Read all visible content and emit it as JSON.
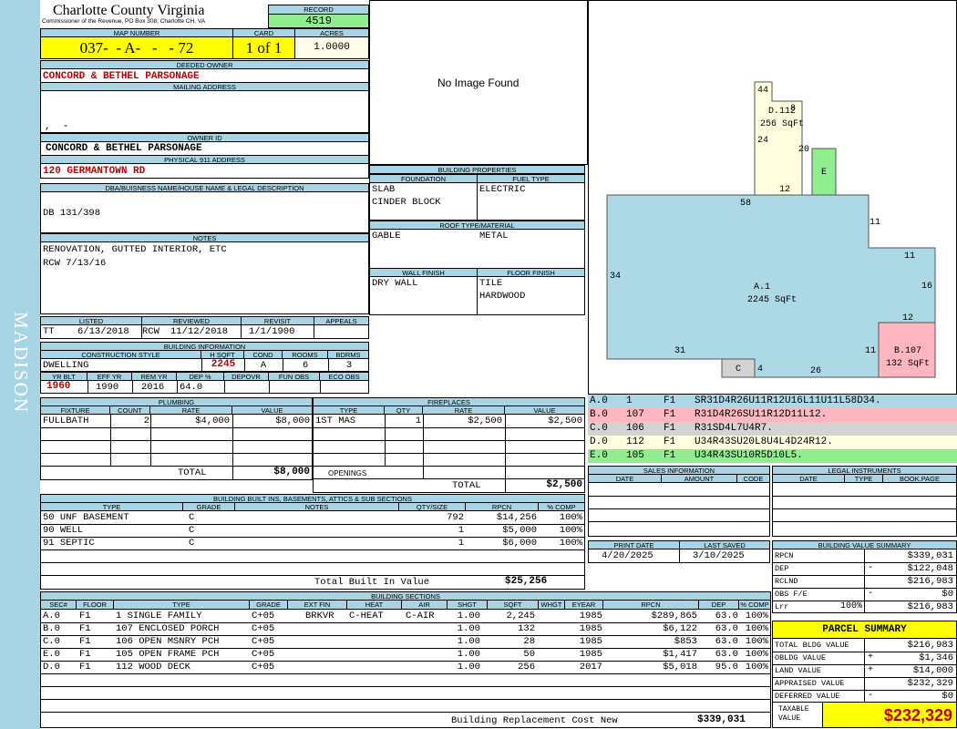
{
  "side_label": "MADISON",
  "header": {
    "county": "Charlotte County Virginia",
    "commissioner": "Commissioner of the Revenue, PO Box 308, Charlotte CH, VA",
    "record_label": "RECORD",
    "record": "4519",
    "map_label": "MAP NUMBER",
    "map": "037-  - A-   -   - 72",
    "card_label": "CARD",
    "card": "1 of 1",
    "acres_label": "ACRES",
    "acres": "1.0000"
  },
  "owner": {
    "deeded_label": "DEEDED OWNER",
    "deeded": "CONCORD & BETHEL PARSONAGE",
    "mailing_label": "MAILING ADDRESS",
    "mailing": ",  -",
    "owner_id_label": "OWNER ID",
    "owner_id": "CONCORD & BETHEL PARSONAGE",
    "physical_label": "PHYSICAL 911 ADDRESS",
    "physical": "120 GERMANTOWN RD",
    "dba_label": "DBA/BUISNESS NAME/HOUSE NAME & LEGAL DESCRIPTION",
    "dba": "DB 131/398",
    "notes_label": "NOTES",
    "notes": [
      "RENOVATION, GUTTED INTERIOR, ETC",
      "RCW 7/13/16"
    ]
  },
  "image_text": "No Image Found",
  "building_props": {
    "title": "BUILDING PROPERTIES",
    "foundation_label": "FOUNDATION",
    "fuel_label": "FUEL TYPE",
    "foundation": [
      "SLAB",
      "CINDER BLOCK"
    ],
    "fuel": "ELECTRIC",
    "roof_label": "ROOF TYPE/MATERIAL",
    "roof_type": "GABLE",
    "roof_mat": "METAL",
    "wall_label": "WALL FINISH",
    "floor_label": "FLOOR FINISH",
    "wall": "DRY WALL",
    "floor": [
      "TILE",
      "HARDWOOD"
    ]
  },
  "dates": {
    "listed_label": "LISTED",
    "reviewed_label": "REVIEWED",
    "revisit_label": "REVISIT",
    "appeals_label": "APPEALS",
    "listed_by": "TT",
    "listed": "6/13/2018",
    "reviewed_by": "RCW",
    "reviewed": "11/12/2018",
    "revisit": "1/1/1900",
    "appeals": ""
  },
  "bldg_info": {
    "title": "BUILDING INFORMATION",
    "style_label": "CONSTRUCTION STYLE",
    "hsqft_label": "H SQFT",
    "cond_label": "COND",
    "rooms_label": "ROOMS",
    "bdrms_label": "BDRMS",
    "style": "DWELLING",
    "hsqft": "2245",
    "cond": "A",
    "rooms": "6",
    "bdrms": "3",
    "yrblt_label": "YR BLT",
    "effyr_label": "EFF YR",
    "remyr_label": "REM YR",
    "dep_label": "DEP %",
    "depovr_label": "DEPOVR",
    "funobs_label": "FUN OBS",
    "ecoobs_label": "ECO OBS",
    "yrblt": "1960",
    "effyr": "1990",
    "remyr": "2016",
    "dep": "64.0"
  },
  "plumbing": {
    "title": "PLUMBING",
    "cols": [
      "FIXTURE",
      "COUNT",
      "RATE",
      "VALUE"
    ],
    "rows": [
      {
        "fixture": "FULLBATH",
        "count": "2",
        "rate": "$4,000",
        "value": "$8,000"
      }
    ],
    "total_label": "TOTAL",
    "total": "$8,000"
  },
  "fireplaces": {
    "title": "FIREPLACES",
    "cols": [
      "TYPE",
      "QTY",
      "RATE",
      "VALUE"
    ],
    "rows": [
      {
        "type": "1ST MAS",
        "qty": "1",
        "rate": "$2,500",
        "value": "$2,500"
      }
    ],
    "openings_label": "OPENINGS",
    "total_label": "TOTAL",
    "total": "$2,500"
  },
  "builtins": {
    "title": "BUILDING BUILT INS, BASEMENTS, ATTICS & SUB SECTIONS",
    "cols": [
      "TYPE",
      "GRADE",
      "NOTES",
      "QTY/SIZE",
      "RPCN",
      "% COMP"
    ],
    "rows": [
      {
        "type": "50 UNF BASEMENT",
        "grade": "C",
        "qty": "792",
        "rpcn": "$14,256",
        "comp": "100%"
      },
      {
        "type": "90 WELL",
        "grade": "C",
        "qty": "1",
        "rpcn": "$5,000",
        "comp": "100%"
      },
      {
        "type": "91 SEPTIC",
        "grade": "C",
        "qty": "1",
        "rpcn": "$6,000",
        "comp": "100%"
      }
    ],
    "total_label": "Total Built In Value",
    "total": "$25,256"
  },
  "sections": {
    "title": "BUILDING SECTIONS",
    "cols": [
      "SEC#",
      "FLOOR",
      "TYPE",
      "GRADE",
      "EXT FIN",
      "HEAT",
      "AIR",
      "SHGT",
      "SQFT",
      "WHGT",
      "EYEAR",
      "RPCN",
      "DEP",
      "% COMP"
    ],
    "rows": [
      {
        "sec": "A.0",
        "floor": "F1",
        "type": "1 SINGLE FAMILY",
        "grade": "C+05",
        "ext": "BRKVR",
        "heat": "C-HEAT",
        "air": "C-AIR",
        "shgt": "1.00",
        "sqft": "2,245",
        "eyear": "1985",
        "rpcn": "$289,865",
        "dep": "63.0",
        "comp": "100%"
      },
      {
        "sec": "B.0",
        "floor": "F1",
        "type": "107 ENCLOSED PORCH",
        "grade": "C+05",
        "ext": "",
        "heat": "",
        "air": "",
        "shgt": "1.00",
        "sqft": "132",
        "eyear": "1985",
        "rpcn": "$6,122",
        "dep": "63.0",
        "comp": "100%"
      },
      {
        "sec": "C.0",
        "floor": "F1",
        "type": "106 OPEN MSNRY PCH",
        "grade": "C+05",
        "ext": "",
        "heat": "",
        "air": "",
        "shgt": "1.00",
        "sqft": "28",
        "eyear": "1985",
        "rpcn": "$853",
        "dep": "63.0",
        "comp": "100%"
      },
      {
        "sec": "E.0",
        "floor": "F1",
        "type": "105 OPEN FRAME PCH",
        "grade": "C+05",
        "ext": "",
        "heat": "",
        "air": "",
        "shgt": "1.00",
        "sqft": "50",
        "eyear": "1985",
        "rpcn": "$1,417",
        "dep": "63.0",
        "comp": "100%"
      },
      {
        "sec": "D.0",
        "floor": "F1",
        "type": "112 WOOD DECK",
        "grade": "C+05",
        "ext": "",
        "heat": "",
        "air": "",
        "shgt": "1.00",
        "sqft": "256",
        "eyear": "2017",
        "rpcn": "$5,018",
        "dep": "95.0",
        "comp": "100%"
      }
    ],
    "repl_label": "Building Replacement Cost New",
    "repl": "$339,031"
  },
  "sketch": {
    "a_label": "A.1",
    "a_sqft": "2245 SqFt",
    "b_label": "B.107",
    "b_sqft": "132 SqFt",
    "c_label": "C",
    "d_label": "D.112",
    "d_sqft": "256 SqFt",
    "e_label": "E",
    "dims": [
      "44",
      "8",
      "24",
      "20",
      "12",
      "58",
      "11",
      "11",
      "34",
      "16",
      "12",
      "31",
      "11",
      "4",
      "26"
    ],
    "colors": {
      "a": "#add8e6",
      "b": "#ffb6c1",
      "c": "#d3d3d3",
      "d": "#ffffe0",
      "e": "#90ee90"
    }
  },
  "vectors": [
    {
      "sec": "A.0",
      "code": "1",
      "floor": "F1",
      "vec": "SR31D4R26U11R12U16L11U11L58D34.",
      "color": "#add8e6"
    },
    {
      "sec": "B.0",
      "code": "107",
      "floor": "F1",
      "vec": "R31D4R26SU11R12D11L12.",
      "color": "#ffb6c1"
    },
    {
      "sec": "C.0",
      "code": "106",
      "floor": "F1",
      "vec": "R31SD4L7U4R7.",
      "color": "#d3d3d3"
    },
    {
      "sec": "D.0",
      "code": "112",
      "floor": "F1",
      "vec": "U34R43SU20L8U4L4D24R12.",
      "color": "#ffffe0"
    },
    {
      "sec": "E.0",
      "code": "105",
      "floor": "F1",
      "vec": "U34R43SU10R5D10L5.",
      "color": "#90ee90"
    }
  ],
  "sales": {
    "title": "SALES INFORMATION",
    "cols": [
      "DATE",
      "AMOUNT",
      "CODE"
    ]
  },
  "legal": {
    "title": "LEGAL INSTRUMENTS",
    "cols": [
      "DATE",
      "TYPE",
      "BOOK.PAGE"
    ]
  },
  "print": {
    "print_label": "PRINT DATE",
    "saved_label": "LAST SAVED",
    "print": "4/20/2025",
    "saved": "3/10/2025"
  },
  "value_summary": {
    "title": "BUILDING VALUE SUMMARY",
    "rows": [
      {
        "label": "RPCN",
        "sign": "",
        "pct": "",
        "value": "$339,031"
      },
      {
        "label": "DEP",
        "sign": "-",
        "pct": "",
        "value": "$122,048"
      },
      {
        "label": "RCLND",
        "sign": "",
        "pct": "",
        "value": "$216,983"
      },
      {
        "label": "OBS F/E",
        "sign": "-",
        "pct": "",
        "value": "$0"
      },
      {
        "label": "Lrr",
        "sign": "",
        "pct": "100%",
        "value": "$216,983"
      }
    ]
  },
  "parcel": {
    "title": "PARCEL SUMMARY",
    "rows": [
      {
        "label": "TOTAL BLDG VALUE",
        "sign": "",
        "value": "$216,983"
      },
      {
        "label": "OBLDG VALUE",
        "sign": "+",
        "value": "$1,346"
      },
      {
        "label": "LAND VALUE",
        "sign": "+",
        "value": "$14,000"
      },
      {
        "label": "APPRAISED VALUE",
        "sign": "",
        "value": "$232,329"
      },
      {
        "label": "DEFERRED VALUE",
        "sign": "-",
        "value": "$0"
      }
    ],
    "taxable_label": "TAXABLE VALUE",
    "taxable": "$232,329"
  }
}
